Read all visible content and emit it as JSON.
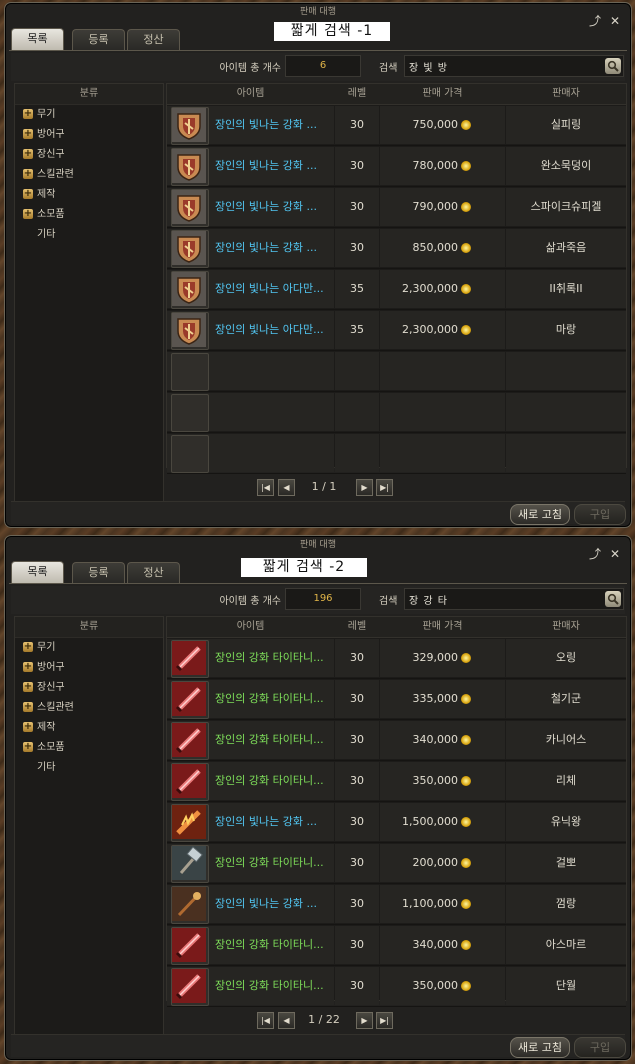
{
  "windows": [
    {
      "title": "판매 대행",
      "caption": "짧게 검색 -1",
      "tabs": [
        "목록",
        "등록",
        "정산"
      ],
      "count_label": "아이템 총 개수",
      "count": "6",
      "search_label": "검색",
      "search_value": "장 빛 방",
      "category_header": "분류",
      "categories": [
        "무기",
        "방어구",
        "장신구",
        "스킬관련",
        "제작",
        "소모품",
        "기타"
      ],
      "columns": {
        "item": "아이템",
        "level": "레벨",
        "price": "판매 가격",
        "seller": "판매자"
      },
      "rows": [
        {
          "name": "장인의 빛나는 강화 ...",
          "level": "30",
          "price": "750,000",
          "seller": "실피링",
          "icon": "shield-icon"
        },
        {
          "name": "장인의 빛나는 강화 ...",
          "level": "30",
          "price": "780,000",
          "seller": "완소묵덩이",
          "icon": "shield-icon"
        },
        {
          "name": "장인의 빛나는 강화 ...",
          "level": "30",
          "price": "790,000",
          "seller": "스파이크슈피겔",
          "icon": "shield-icon"
        },
        {
          "name": "장인의 빛나는 강화 ...",
          "level": "30",
          "price": "850,000",
          "seller": "삶과죽음",
          "icon": "shield-icon"
        },
        {
          "name": "장인의 빛나는 아다만...",
          "level": "35",
          "price": "2,300,000",
          "seller": "II취록II",
          "icon": "shield-icon"
        },
        {
          "name": "장인의 빛나는 아다만...",
          "level": "35",
          "price": "2,300,000",
          "seller": "마랑",
          "icon": "shield-icon"
        }
      ],
      "empty_rows": 3,
      "page": "1 / 1",
      "refresh_label": "새로 고침",
      "buy_label": "구입"
    },
    {
      "title": "판매 대행",
      "caption": "짧게 검색 -2",
      "tabs": [
        "목록",
        "등록",
        "정산"
      ],
      "count_label": "아이템 총 개수",
      "count": "196",
      "search_label": "검색",
      "search_value": "장 강 타",
      "category_header": "분류",
      "categories": [
        "무기",
        "방어구",
        "장신구",
        "스킬관련",
        "제작",
        "소모품",
        "기타"
      ],
      "columns": {
        "item": "아이템",
        "level": "레벨",
        "price": "판매 가격",
        "seller": "판매자"
      },
      "rows": [
        {
          "name": "장인의 강화 타이타니...",
          "level": "30",
          "price": "329,000",
          "seller": "오링",
          "icon": "sword-icon",
          "green": true
        },
        {
          "name": "장인의 강화 타이타니...",
          "level": "30",
          "price": "335,000",
          "seller": "철기군",
          "icon": "sword-icon",
          "green": true
        },
        {
          "name": "장인의 강화 타이타니...",
          "level": "30",
          "price": "340,000",
          "seller": "카니어스",
          "icon": "sword-icon",
          "green": true
        },
        {
          "name": "장인의 강화 타이타니...",
          "level": "30",
          "price": "350,000",
          "seller": "리체",
          "icon": "sword-icon",
          "green": true
        },
        {
          "name": "장인의 빛나는 강화 ...",
          "level": "30",
          "price": "1,500,000",
          "seller": "유닉왕",
          "icon": "flame-sword-icon",
          "green": false
        },
        {
          "name": "장인의 강화 타이타니...",
          "level": "30",
          "price": "200,000",
          "seller": "걸뽀",
          "icon": "hammer-icon",
          "green": true
        },
        {
          "name": "장인의 빛나는 강화 ...",
          "level": "30",
          "price": "1,100,000",
          "seller": "껌랑",
          "icon": "staff-icon",
          "green": false
        },
        {
          "name": "장인의 강화 타이타니...",
          "level": "30",
          "price": "340,000",
          "seller": "아스마르",
          "icon": "sword-icon",
          "green": true
        },
        {
          "name": "장인의 강화 타이타니...",
          "level": "30",
          "price": "350,000",
          "seller": "단월",
          "icon": "sword-icon",
          "green": true
        }
      ],
      "empty_rows": 0,
      "page": "1 / 22",
      "refresh_label": "새로 고침",
      "buy_label": "구입"
    }
  ]
}
